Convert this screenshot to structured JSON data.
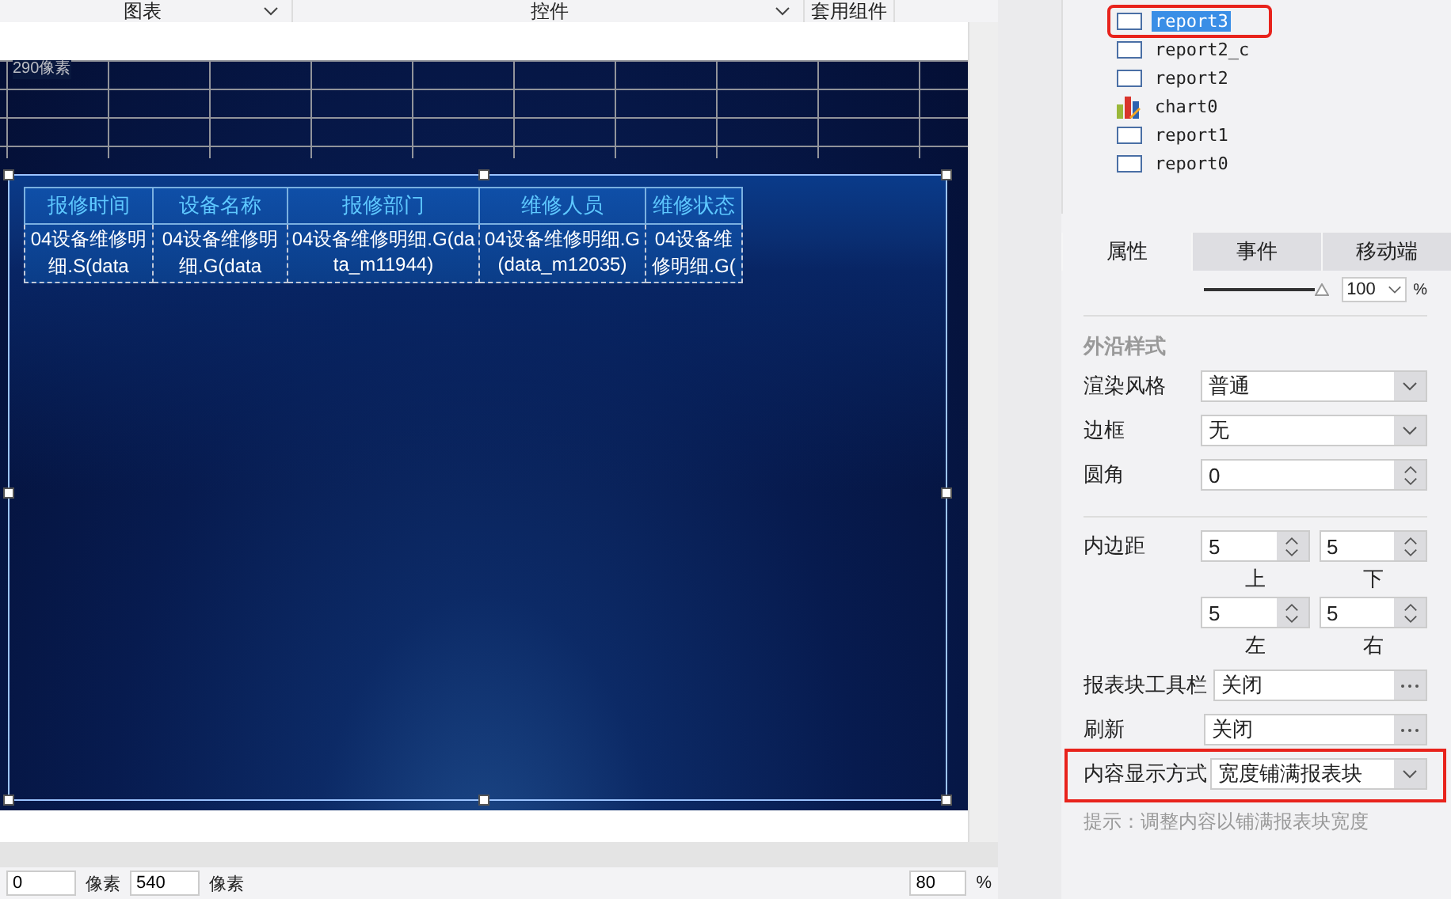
{
  "toolbar": {
    "items": [
      {
        "label": "图表",
        "dropdown": true
      },
      {
        "label": "控件",
        "dropdown": true
      },
      {
        "label": "套用组件",
        "dropdown": false
      }
    ]
  },
  "canvas": {
    "height_label": "290像素",
    "table": {
      "columns": [
        "报修时间",
        "设备名称",
        "报修部门",
        "维修人员",
        "维修状态"
      ],
      "rows": [
        [
          "04设备维修明细.S(data",
          "04设备维修明细.G(data",
          "04设备维修明细.G(data_m11944)",
          "04设备维修明细.G(data_m12035)",
          "04设备维修明细.G("
        ]
      ]
    }
  },
  "bottom_bar": {
    "fields": [
      {
        "value": "0",
        "unit": "像素"
      },
      {
        "value": "540",
        "unit": "像素"
      }
    ],
    "zoom": "80",
    "zoom_unit": "%"
  },
  "tree": {
    "items": [
      {
        "label": "report3",
        "kind": "report",
        "selected": true,
        "highlighted": true
      },
      {
        "label": "report2_c",
        "kind": "report",
        "selected": false,
        "highlighted": false
      },
      {
        "label": "report2",
        "kind": "report",
        "selected": false,
        "highlighted": false
      },
      {
        "label": "chart0",
        "kind": "chart",
        "selected": false,
        "highlighted": false
      },
      {
        "label": "report1",
        "kind": "report",
        "selected": false,
        "highlighted": false
      },
      {
        "label": "report0",
        "kind": "report",
        "selected": false,
        "highlighted": false
      }
    ]
  },
  "panel_tabs": [
    {
      "label": "属性",
      "selected": true
    },
    {
      "label": "事件",
      "selected": false
    },
    {
      "label": "移动端",
      "selected": false
    }
  ],
  "opacity": {
    "level": 1,
    "value": "100",
    "unit": "%"
  },
  "section": "外沿样式",
  "properties": [
    {
      "kind": "select",
      "label": "渲染风格",
      "value": "普通",
      "highlighted": false
    },
    {
      "kind": "select",
      "label": "边框",
      "value": "无",
      "highlighted": false
    },
    {
      "kind": "spinner",
      "label": "圆角",
      "value": "0",
      "highlighted": false
    },
    {
      "kind": "padding",
      "label": "内边距",
      "fields": [
        {
          "value": "5",
          "caption": "上"
        },
        {
          "value": "5",
          "caption": "下"
        },
        {
          "value": "5",
          "caption": "左"
        },
        {
          "value": "5",
          "caption": "右"
        }
      ],
      "highlighted": false
    },
    {
      "kind": "more",
      "label": "报表块工具栏",
      "value": "关闭",
      "highlighted": false
    },
    {
      "kind": "more",
      "label": "刷新",
      "value": "关闭",
      "highlighted": false
    },
    {
      "kind": "select",
      "label": "内容显示方式",
      "value": "宽度铺满报表块",
      "highlighted": true
    }
  ],
  "hint": "提示：调整内容以铺满报表块宽度"
}
